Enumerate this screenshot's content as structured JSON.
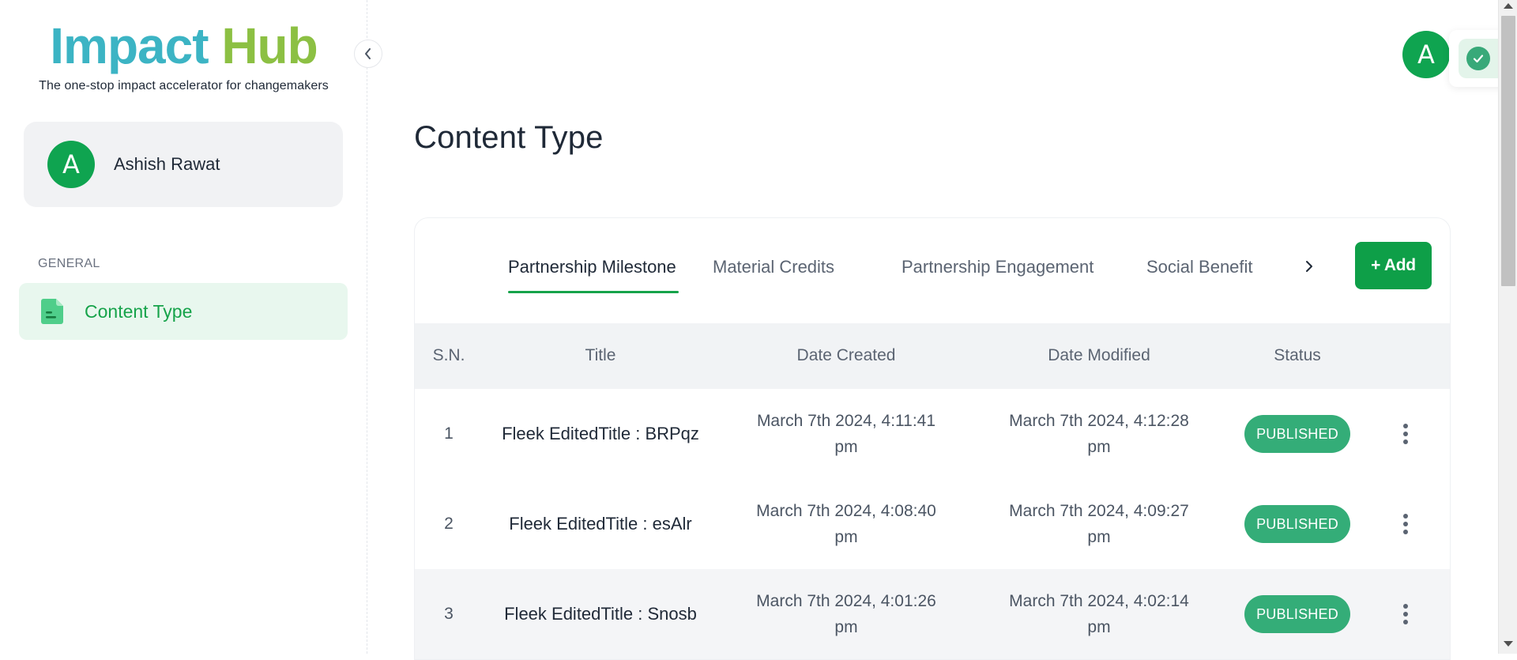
{
  "brand": {
    "title_part1": "Impact",
    "title_part2": "Hub",
    "tagline": "The one-stop impact accelerator for changemakers",
    "color_part1": "#3cb4c4",
    "color_part2": "#8cc043"
  },
  "sidebar": {
    "user": {
      "initial": "A",
      "name": "Ashish Rawat"
    },
    "section_label": "GENERAL",
    "items": [
      {
        "label": "Content Type",
        "icon": "document-icon",
        "active": true
      }
    ]
  },
  "header": {
    "avatar_initial": "A"
  },
  "main": {
    "page_title": "Content Type",
    "tabs": [
      {
        "label": "Partnership Milestone",
        "active": true
      },
      {
        "label": "Material Credits",
        "active": false
      },
      {
        "label": "Partnership Engagement",
        "active": false
      },
      {
        "label": "Social Benefit",
        "active": false
      }
    ],
    "add_label": "+ Add",
    "table": {
      "columns": [
        "S.N.",
        "Title",
        "Date Created",
        "Date Modified",
        "Status"
      ],
      "rows": [
        {
          "sn": "1",
          "title": "Fleek EditedTitle : BRPqz",
          "created_line1": "March 7th 2024, 4:11:41",
          "created_line2": "pm",
          "modified_line1": "March 7th 2024, 4:12:28",
          "modified_line2": "pm",
          "status": "PUBLISHED"
        },
        {
          "sn": "2",
          "title": "Fleek EditedTitle : esAlr",
          "created_line1": "March 7th 2024, 4:08:40",
          "created_line2": "pm",
          "modified_line1": "March 7th 2024, 4:09:27",
          "modified_line2": "pm",
          "status": "PUBLISHED"
        },
        {
          "sn": "3",
          "title": "Fleek EditedTitle : Snosb",
          "created_line1": "March 7th 2024, 4:01:26",
          "created_line2": "pm",
          "modified_line1": "March 7th 2024, 4:02:14",
          "modified_line2": "pm",
          "status": "PUBLISHED"
        }
      ]
    }
  },
  "colors": {
    "accent_green": "#16a34a",
    "avatar_green": "#0fa450",
    "badge_green": "#34ad78"
  }
}
